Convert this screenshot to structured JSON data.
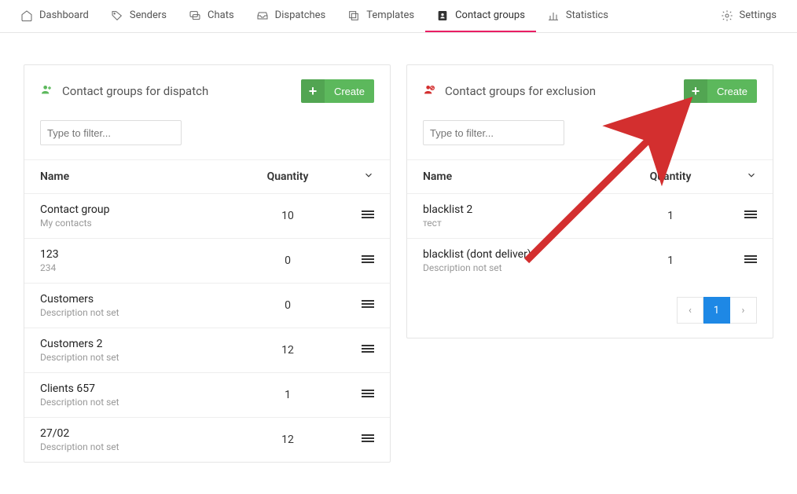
{
  "nav": {
    "items": [
      {
        "label": "Dashboard"
      },
      {
        "label": "Senders"
      },
      {
        "label": "Chats"
      },
      {
        "label": "Dispatches"
      },
      {
        "label": "Templates"
      },
      {
        "label": "Contact groups"
      },
      {
        "label": "Statistics"
      }
    ],
    "settings_label": "Settings"
  },
  "dispatch_panel": {
    "title": "Contact groups for dispatch",
    "create_label": "Create",
    "filter_placeholder": "Type to filter...",
    "col_name": "Name",
    "col_qty": "Quantity",
    "rows": [
      {
        "name": "Contact group",
        "desc": "My contacts",
        "qty": "10"
      },
      {
        "name": "123",
        "desc": "234",
        "qty": "0"
      },
      {
        "name": "Customers",
        "desc": "Description not set",
        "qty": "0"
      },
      {
        "name": "Customers 2",
        "desc": "Description not set",
        "qty": "12"
      },
      {
        "name": "Clients 657",
        "desc": "Description not set",
        "qty": "1"
      },
      {
        "name": "27/02",
        "desc": "Description not set",
        "qty": "12"
      }
    ]
  },
  "exclusion_panel": {
    "title": "Contact groups for exclusion",
    "create_label": "Create",
    "filter_placeholder": "Type to filter...",
    "col_name": "Name",
    "col_qty": "Quantity",
    "rows": [
      {
        "name": "blacklist 2",
        "desc": "тест",
        "qty": "1"
      },
      {
        "name": "blacklist (dont deliver)",
        "desc": "Description not set",
        "qty": "1"
      }
    ],
    "pagination": {
      "prev": "‹",
      "page": "1",
      "next": "›"
    }
  },
  "colors": {
    "accent": "#e91e63",
    "create": "#5cb85c",
    "page_active": "#1e88e5",
    "arrow": "#d32f2f"
  }
}
